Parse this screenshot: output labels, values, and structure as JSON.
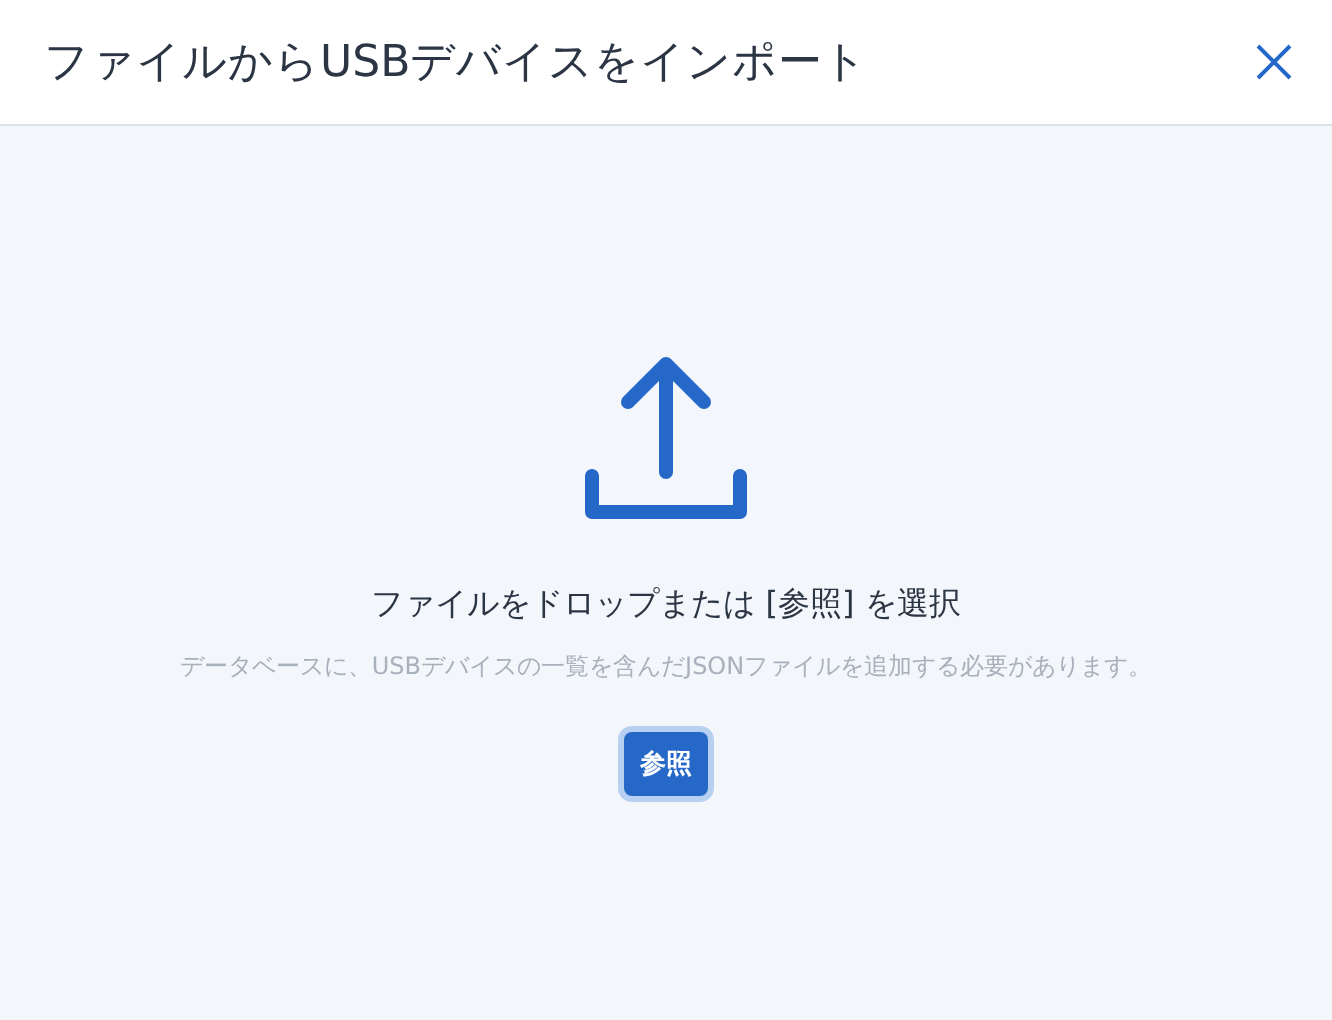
{
  "dialog": {
    "title": "ファイルからUSBデバイスをインポート"
  },
  "dropzone": {
    "heading": "ファイルをドロップまたは [参照] を選択",
    "description": "データベースに、USBデバイスの一覧を含んだJSONファイルを追加する必要があります。",
    "button": "参照"
  }
}
